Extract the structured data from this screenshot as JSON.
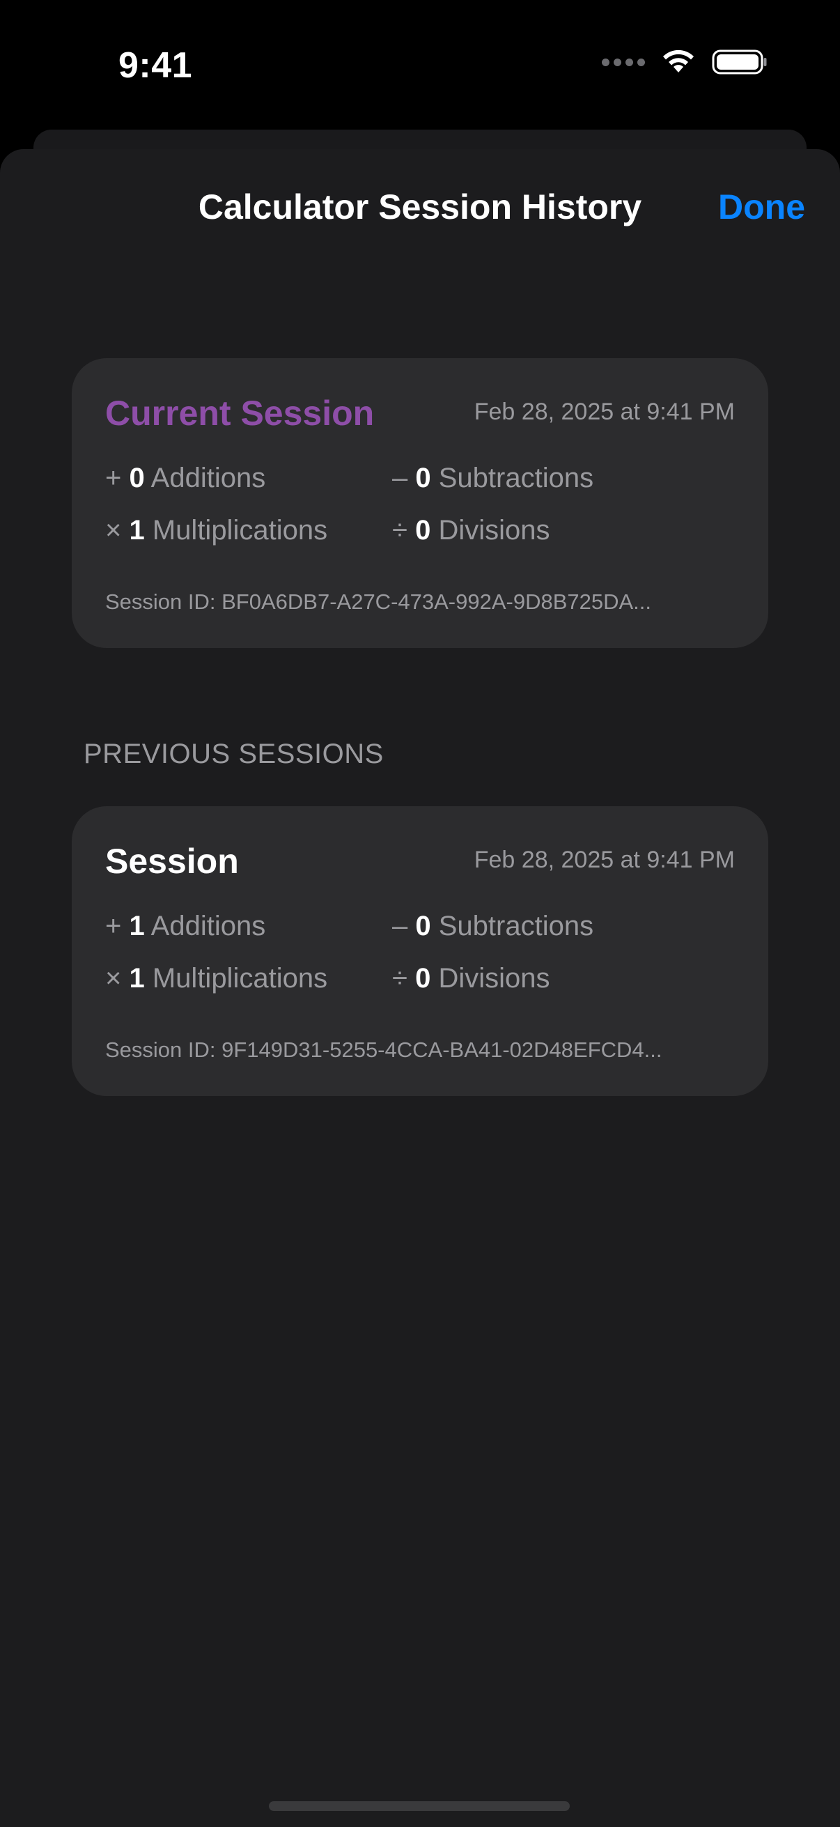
{
  "status_bar": {
    "time": "9:41",
    "icons": [
      "cellular-signal-icon",
      "wifi-icon",
      "battery-icon"
    ]
  },
  "nav": {
    "title": "Calculator Session History",
    "done_label": "Done"
  },
  "colors": {
    "accent": "#0a84ff",
    "current_session_title": "#8e4ea8",
    "sheet_background": "#1c1c1e",
    "card_background": "#2c2c2e",
    "secondary_text": "#9a9a9e"
  },
  "current_session": {
    "title": "Current Session",
    "date": "Feb 28, 2025 at 9:41 PM",
    "stats": {
      "additions": {
        "symbol": "+",
        "count": "0",
        "label": "Additions"
      },
      "subtractions": {
        "symbol": "–",
        "count": "0",
        "label": "Subtractions"
      },
      "multiplications": {
        "symbol": "×",
        "count": "1",
        "label": "Multiplications"
      },
      "divisions": {
        "symbol": "÷",
        "count": "0",
        "label": "Divisions"
      }
    },
    "session_id": "Session ID: BF0A6DB7-A27C-473A-992A-9D8B725DA..."
  },
  "previous_sessions": {
    "header": "PREVIOUS SESSIONS",
    "items": [
      {
        "title": "Session",
        "date": "Feb 28, 2025 at 9:41 PM",
        "stats": {
          "additions": {
            "symbol": "+",
            "count": "1",
            "label": "Additions"
          },
          "subtractions": {
            "symbol": "–",
            "count": "0",
            "label": "Subtractions"
          },
          "multiplications": {
            "symbol": "×",
            "count": "1",
            "label": "Multiplications"
          },
          "divisions": {
            "symbol": "÷",
            "count": "0",
            "label": "Divisions"
          }
        },
        "session_id": "Session ID: 9F149D31-5255-4CCA-BA41-02D48EFCD4..."
      }
    ]
  }
}
